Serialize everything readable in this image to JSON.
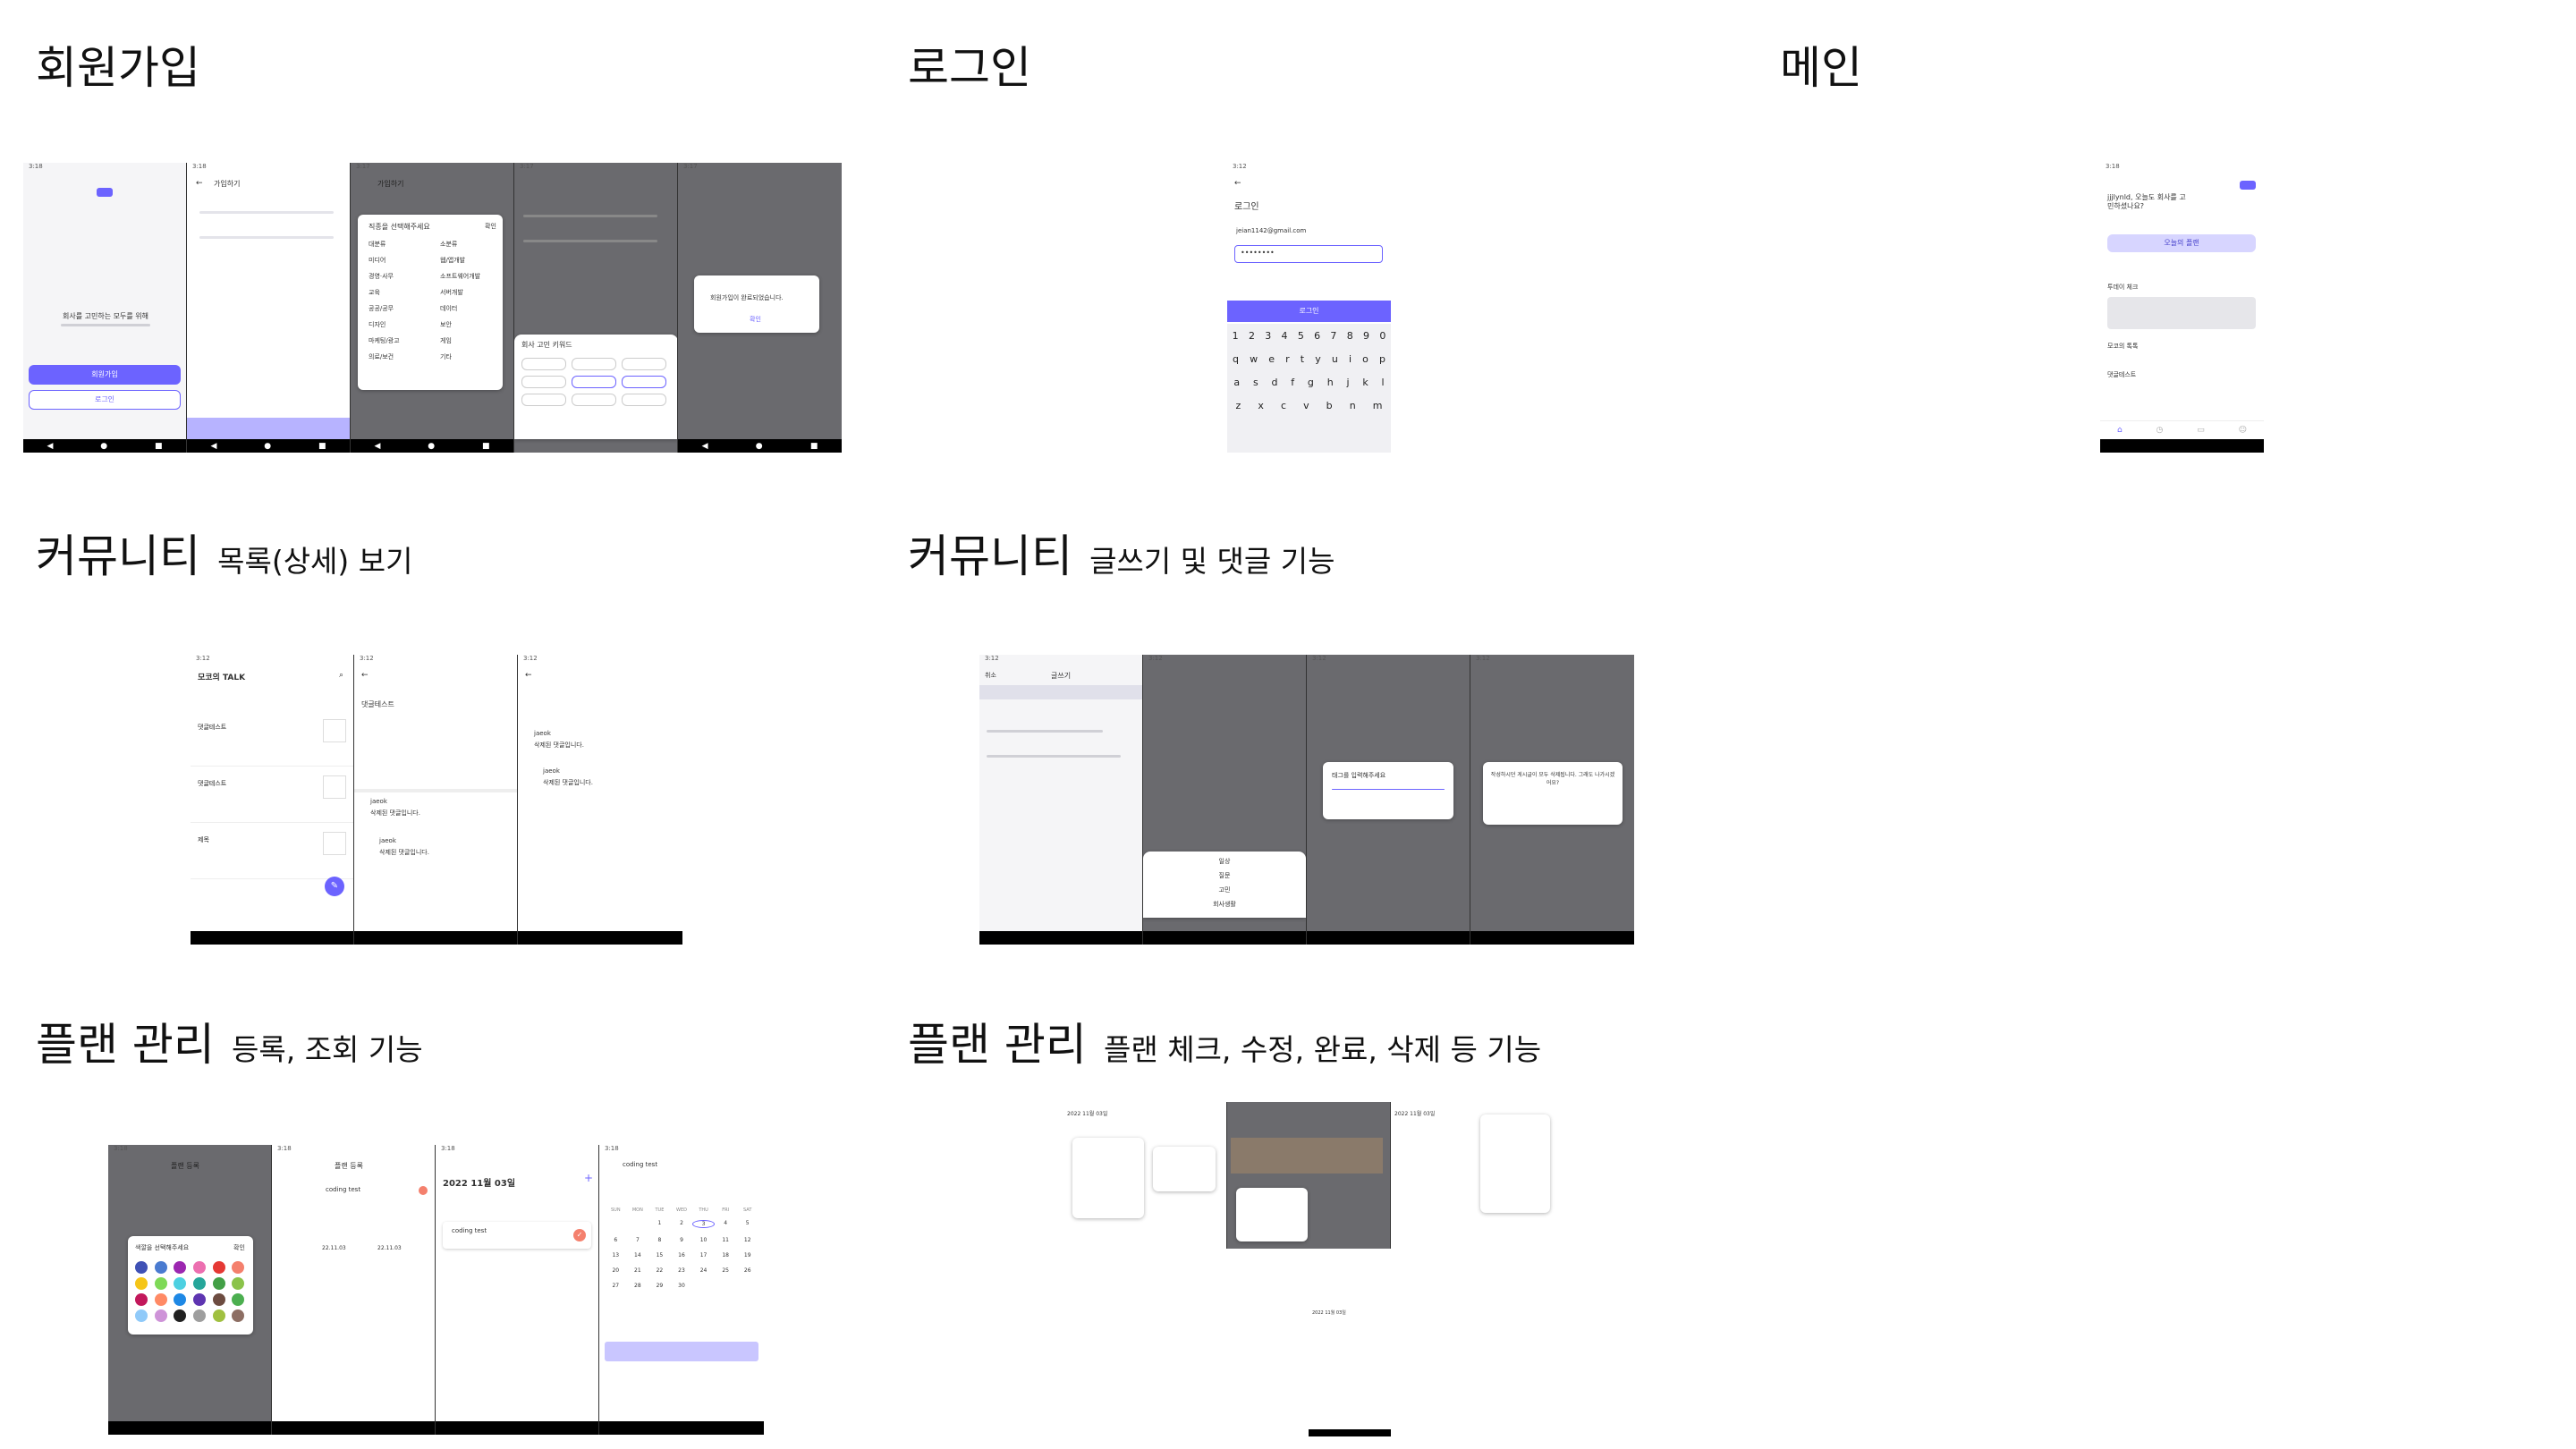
{
  "sections": {
    "signup": {
      "title": "회원가입"
    },
    "login": {
      "title": "로그인"
    },
    "main": {
      "title": "메인"
    },
    "community_list": {
      "title": "커뮤니티",
      "subtitle": "목록(상세) 보기"
    },
    "community_write": {
      "title": "커뮤니티",
      "subtitle": "글쓰기 및 댓글 기능"
    },
    "plan_register": {
      "title": "플랜 관리",
      "subtitle": "등록, 조회 기능"
    },
    "plan_manage": {
      "title": "플랜 관리",
      "subtitle": "플랜 체크, 수정, 완료, 삭제 등 기능"
    }
  },
  "screens": {
    "signup": {
      "tagline": "회사를 고민하는 모두를 위해",
      "signup_button": "회원가입",
      "login_button": "로그인",
      "signup_header": "가입하기",
      "job_dialog_title": "직종을 선택해주세요",
      "job_dialog_confirm": "확인",
      "job_col_main": "대분류",
      "job_col_sub": "소분류",
      "job_main_items": [
        "미디어",
        "경영·사무",
        "교육",
        "공공/공무",
        "디자인",
        "마케팅/광고",
        "의료/보건"
      ],
      "job_sub_items": [
        "웹/앱개발",
        "소프트웨어개발",
        "서버개발",
        "데이터",
        "보안",
        "게임",
        "기타"
      ],
      "keyword_dialog_title": "회사 고민 키워드",
      "done_dialog_text": "회원가입이 완료되었습니다.",
      "done_dialog_confirm": "확인"
    },
    "login": {
      "header": "로그인",
      "email_value": "jeian1142@gmail.com",
      "password_value": "••••••••",
      "login_button": "로그인",
      "keyboard_numbers": [
        "1",
        "2",
        "3",
        "4",
        "5",
        "6",
        "7",
        "8",
        "9",
        "0"
      ],
      "keyboard_row1": [
        "q",
        "w",
        "e",
        "r",
        "t",
        "y",
        "u",
        "i",
        "o",
        "p"
      ],
      "keyboard_row2": [
        "a",
        "s",
        "d",
        "f",
        "g",
        "h",
        "j",
        "k",
        "l"
      ],
      "keyboard_row3": [
        "z",
        "x",
        "c",
        "v",
        "b",
        "n",
        "m"
      ]
    },
    "main": {
      "greeting": "jjjlynld, 오늘도 회사를 고민하셨나요?",
      "plan_button": "오늘의 플랜",
      "section_plan": "투데이 체크",
      "section_board": "모코의 톡톡",
      "board_item": "댓글테스트"
    },
    "community_list": {
      "board_title": "모코의 TALK",
      "posts": [
        "댓글테스트",
        "댓글테스트",
        "제목"
      ],
      "detail_title": "댓글테스트",
      "comment_author": "jaeok",
      "comment_text": "삭제된 댓글입니다."
    },
    "community_write": {
      "header": "글쓰기",
      "cancel": "취소",
      "tag_dialog_title": "태그를 입력해주세요",
      "exit_dialog_text": "작성하시던 게시글이 모두 삭제됩니다. 그래도 나가시겠어요?",
      "sheet_items": [
        "일상",
        "질문",
        "고민",
        "회사생활"
      ]
    },
    "plan_register": {
      "header": "플랜 등록",
      "plan_name_value": "coding test",
      "color_dialog_title": "색깔을 선택해주세요",
      "color_dialog_confirm": "확인",
      "date": "2022 11월 03일",
      "plan_item": "coding test",
      "date_start": "22.11.03",
      "date_end": "22.11.03",
      "weekdays": [
        "SUN",
        "MON",
        "TUE",
        "WED",
        "THU",
        "FRI",
        "SAT"
      ],
      "calendar_days": [
        "1",
        "2",
        "3",
        "4",
        "5",
        "6",
        "7",
        "8",
        "9",
        "10",
        "11",
        "12",
        "13",
        "14",
        "15",
        "16",
        "17",
        "18",
        "19",
        "20",
        "21",
        "22",
        "23",
        "24",
        "25",
        "26",
        "27",
        "28",
        "29",
        "30"
      ]
    },
    "plan_manage": {
      "header": "2022 11월 03일"
    }
  },
  "colors": {
    "accent": "#6c63ff",
    "dim_overlay": "#6a6a6e",
    "palette": [
      "#3f51b5",
      "#4a7bd0",
      "#9c27b0",
      "#ec6fb0",
      "#e53935",
      "#f4806d",
      "#f5c518",
      "#7ed957",
      "#4dd0e1",
      "#26a69a",
      "#43a047",
      "#8bc34a",
      "#c2185b",
      "#ff8a65",
      "#1e88e5",
      "#5e35b1",
      "#6d4c41",
      "#4caf50",
      "#90caf9",
      "#ce93d8",
      "#212121",
      "#9e9e9e",
      "#a0c040",
      "#8d6e63"
    ]
  }
}
